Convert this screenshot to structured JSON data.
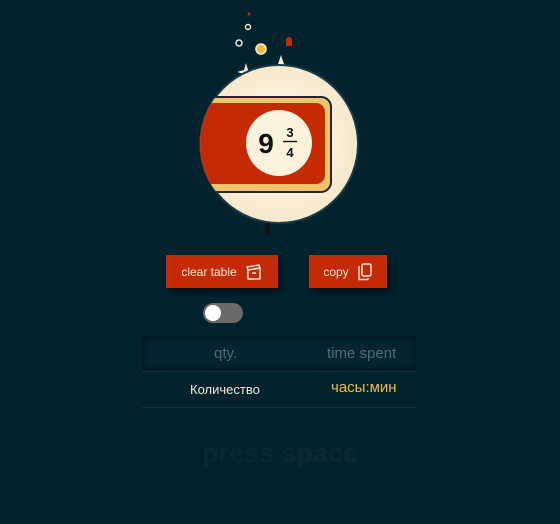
{
  "badge": {
    "whole": "9",
    "numerator": "3",
    "denominator": "4"
  },
  "buttons": {
    "clear_label": "clear table",
    "copy_label": "copy"
  },
  "toggle": {
    "checked": false
  },
  "table": {
    "columns": [
      "qty.",
      "time spent"
    ],
    "rows": [
      {
        "qty": "Количество",
        "time": "часы:мин"
      }
    ]
  },
  "hint": "press space",
  "colors": {
    "background": "#02232e",
    "accent": "#c42a06",
    "highlight": "#f0bd3a",
    "cream": "#fdf3dd"
  }
}
